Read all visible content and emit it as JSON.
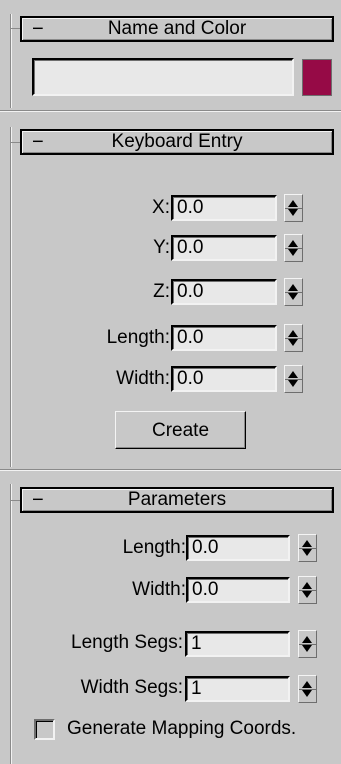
{
  "name_and_color": {
    "title": "Name and Color",
    "collapse_glyph": "−",
    "name_value": "",
    "color": "#960a46"
  },
  "keyboard_entry": {
    "title": "Keyboard Entry",
    "collapse_glyph": "−",
    "fields": [
      {
        "label": "X:",
        "value": "0.0"
      },
      {
        "label": "Y:",
        "value": "0.0"
      },
      {
        "label": "Z:",
        "value": "0.0"
      },
      {
        "label": "Length:",
        "value": "0.0"
      },
      {
        "label": "Width:",
        "value": "0.0"
      }
    ],
    "create_label": "Create"
  },
  "parameters": {
    "title": "Parameters",
    "collapse_glyph": "−",
    "fields": [
      {
        "label": "Length:",
        "value": "0.0"
      },
      {
        "label": "Width:",
        "value": "0.0"
      },
      {
        "label": "Length Segs:",
        "value": "1"
      },
      {
        "label": "Width Segs:",
        "value": "1"
      }
    ],
    "generate_mapping_label": "Generate Mapping Coords.",
    "generate_mapping_checked": false
  }
}
